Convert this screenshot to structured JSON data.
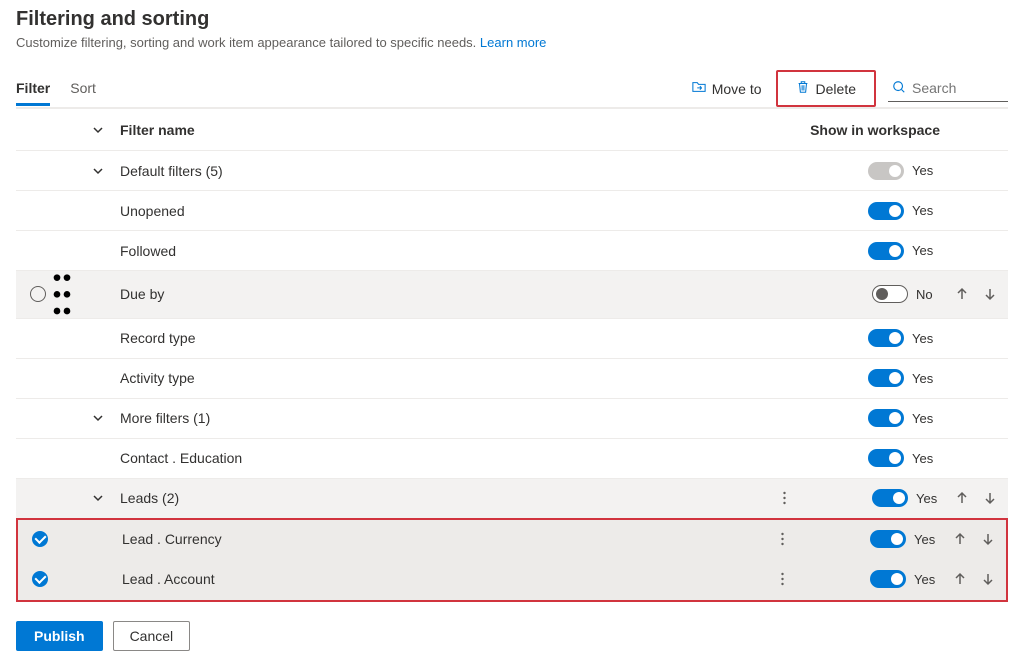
{
  "header": {
    "title": "Filtering and sorting",
    "subtitle_prefix": "Customize filtering, sorting and work item appearance tailored to specific needs.",
    "learn_more": "Learn more"
  },
  "tabs": {
    "filter": "Filter",
    "sort": "Sort"
  },
  "toolbar": {
    "move_to": "Move to",
    "delete": "Delete",
    "search_placeholder": "Search"
  },
  "columns": {
    "filter_name": "Filter name",
    "show_in_workspace": "Show in workspace"
  },
  "rows": {
    "default_filters": {
      "label": "Default filters (5)",
      "toggle": "disabled",
      "value": "Yes"
    },
    "unopened": {
      "label": "Unopened",
      "toggle": "on",
      "value": "Yes"
    },
    "followed": {
      "label": "Followed",
      "toggle": "on",
      "value": "Yes"
    },
    "due_by": {
      "label": "Due by",
      "toggle": "off",
      "value": "No"
    },
    "record_type": {
      "label": "Record type",
      "toggle": "on",
      "value": "Yes"
    },
    "activity_type": {
      "label": "Activity type",
      "toggle": "on",
      "value": "Yes"
    },
    "more_filters": {
      "label": "More filters (1)",
      "toggle": "on",
      "value": "Yes"
    },
    "contact_education": {
      "label": "Contact . Education",
      "toggle": "on",
      "value": "Yes"
    },
    "leads": {
      "label": "Leads (2)",
      "toggle": "on",
      "value": "Yes"
    },
    "lead_currency": {
      "label": "Lead . Currency",
      "toggle": "on",
      "value": "Yes"
    },
    "lead_account": {
      "label": "Lead . Account",
      "toggle": "on",
      "value": "Yes"
    }
  },
  "footer": {
    "publish": "Publish",
    "cancel": "Cancel"
  }
}
